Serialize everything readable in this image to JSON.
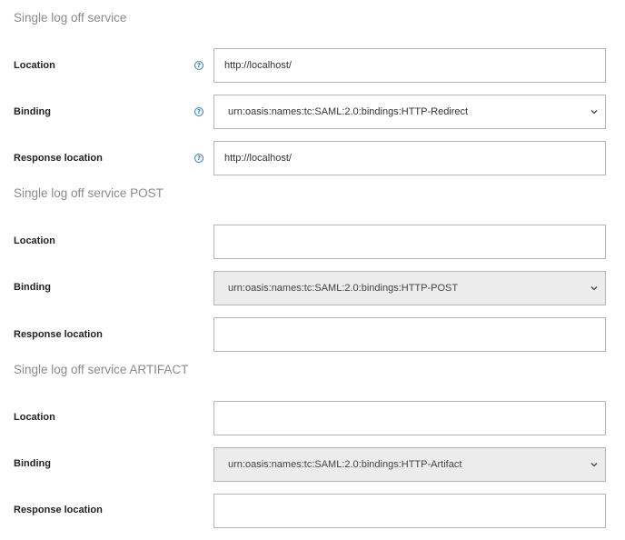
{
  "sections": [
    {
      "title": "Single log off service",
      "location_label": "Location",
      "location_value": "http://localhost/",
      "binding_label": "Binding",
      "binding_value": "urn:oasis:names:tc:SAML:2.0:bindings:HTTP-Redirect",
      "response_label": "Response location",
      "response_value": "http://localhost/",
      "help_icon": "question-circle",
      "binding_disabled": false
    },
    {
      "title": "Single log off service POST",
      "location_label": "Location",
      "location_value": "",
      "binding_label": "Binding",
      "binding_value": "urn:oasis:names:tc:SAML:2.0:bindings:HTTP-POST",
      "response_label": "Response location",
      "response_value": "",
      "binding_disabled": true
    },
    {
      "title": "Single log off service ARTIFACT",
      "location_label": "Location",
      "location_value": "",
      "binding_label": "Binding",
      "binding_value": "urn:oasis:names:tc:SAML:2.0:bindings:HTTP-Artifact",
      "response_label": "Response location",
      "response_value": "",
      "binding_disabled": true
    }
  ],
  "colors": {
    "help_icon": "#2a7bc4",
    "section_title": "#8a8a8a",
    "disabled_bg": "#ececec"
  }
}
